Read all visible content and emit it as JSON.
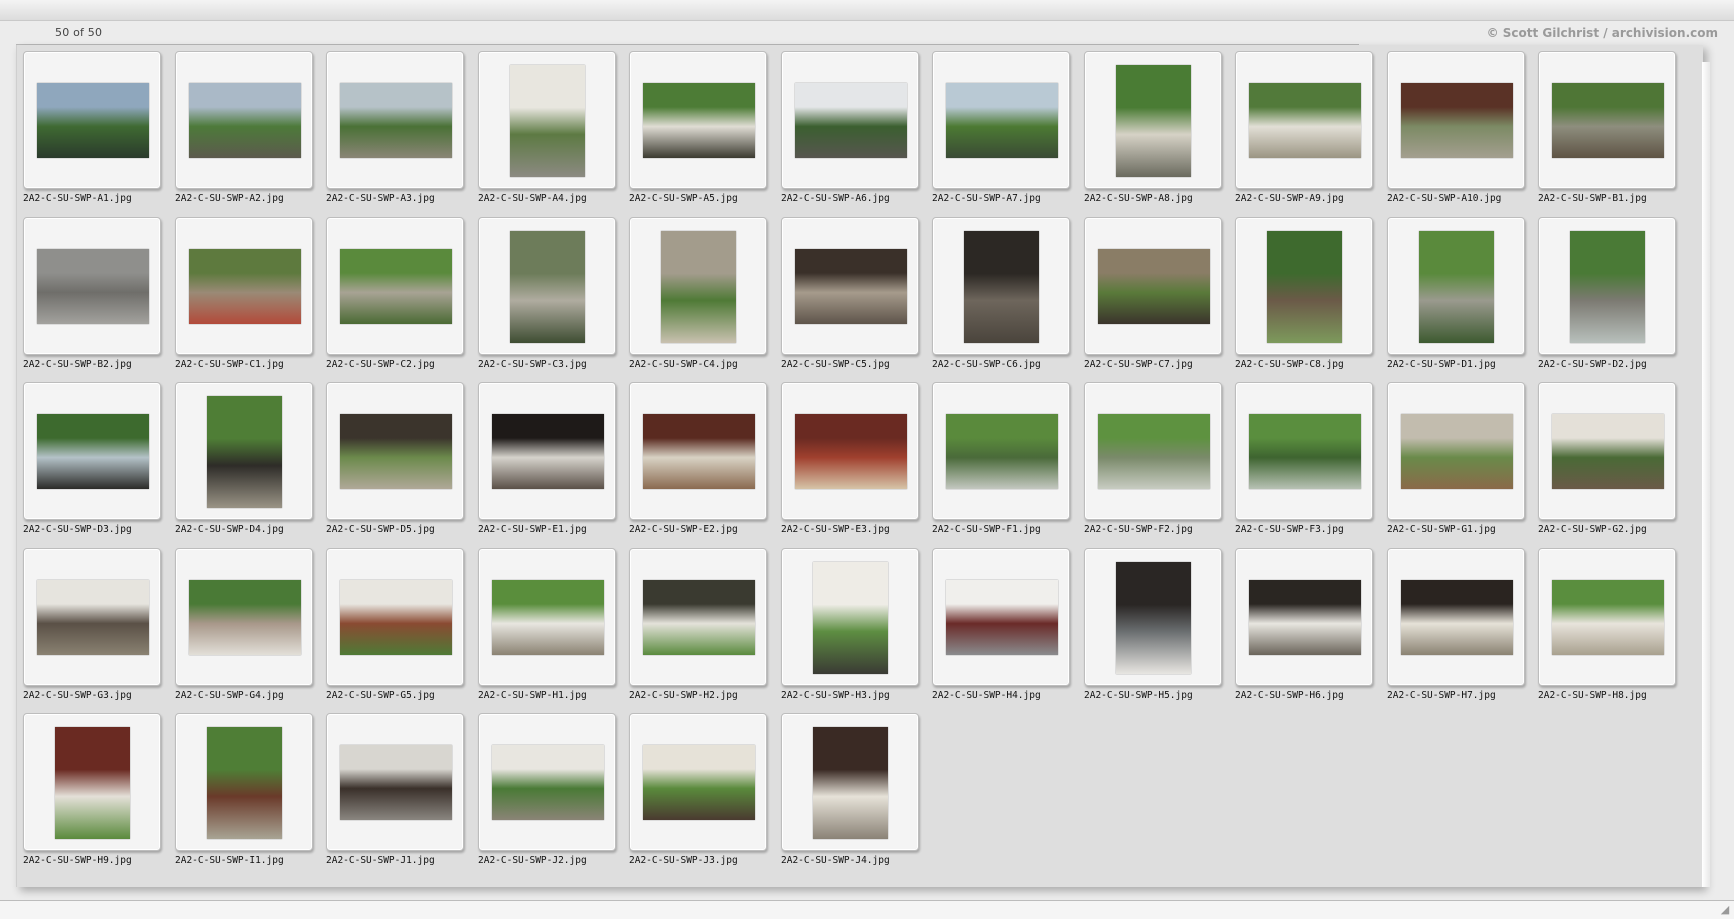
{
  "header": {
    "counter": "50 of 50",
    "copyright": "© Scott Gilchrist / archivision.com"
  },
  "gallery": {
    "items": [
      {
        "filename": "2A2-C-SU-SWP-A1.jpg",
        "orientation": "landscape",
        "palette": [
          "#8fa7bd",
          "#3f6a32",
          "#2a3a2c"
        ]
      },
      {
        "filename": "2A2-C-SU-SWP-A2.jpg",
        "orientation": "landscape",
        "palette": [
          "#aab9c7",
          "#4d7a3a",
          "#5c5a4d"
        ]
      },
      {
        "filename": "2A2-C-SU-SWP-A3.jpg",
        "orientation": "landscape",
        "palette": [
          "#b6c2c8",
          "#4a7136",
          "#8a8576"
        ]
      },
      {
        "filename": "2A2-C-SU-SWP-A4.jpg",
        "orientation": "portrait",
        "palette": [
          "#e8e6df",
          "#5d7a43",
          "#8c8a82"
        ]
      },
      {
        "filename": "2A2-C-SU-SWP-A5.jpg",
        "orientation": "landscape",
        "palette": [
          "#4d7c36",
          "#e0ddd4",
          "#3b3a30"
        ]
      },
      {
        "filename": "2A2-C-SU-SWP-A6.jpg",
        "orientation": "landscape",
        "palette": [
          "#e4e6e8",
          "#3b5f30",
          "#57564f"
        ]
      },
      {
        "filename": "2A2-C-SU-SWP-A7.jpg",
        "orientation": "landscape",
        "palette": [
          "#b9c9d4",
          "#4c7a33",
          "#3a4a35"
        ]
      },
      {
        "filename": "2A2-C-SU-SWP-A8.jpg",
        "orientation": "portrait",
        "palette": [
          "#4a7c34",
          "#d6d2c6",
          "#6a6a5e"
        ]
      },
      {
        "filename": "2A2-C-SU-SWP-A9.jpg",
        "orientation": "landscape",
        "palette": [
          "#527a3a",
          "#e2dfd6",
          "#9b9583"
        ]
      },
      {
        "filename": "2A2-C-SU-SWP-A10.jpg",
        "orientation": "landscape",
        "palette": [
          "#5a3226",
          "#7c8a64",
          "#a49f90"
        ]
      },
      {
        "filename": "2A2-C-SU-SWP-B1.jpg",
        "orientation": "landscape",
        "palette": [
          "#4f7636",
          "#8e8e7e",
          "#5e5344"
        ]
      },
      {
        "filename": "2A2-C-SU-SWP-B2.jpg",
        "orientation": "landscape",
        "palette": [
          "#8f8f8c",
          "#6f6e6a",
          "#a3a29e"
        ]
      },
      {
        "filename": "2A2-C-SU-SWP-C1.jpg",
        "orientation": "landscape",
        "palette": [
          "#5e7a3e",
          "#9a8a76",
          "#b24a3a"
        ]
      },
      {
        "filename": "2A2-C-SU-SWP-C2.jpg",
        "orientation": "landscape",
        "palette": [
          "#5a8a3c",
          "#a8a394",
          "#4b6a34"
        ]
      },
      {
        "filename": "2A2-C-SU-SWP-C3.jpg",
        "orientation": "portrait",
        "palette": [
          "#6d7c5a",
          "#b0aca0",
          "#3e4d32"
        ]
      },
      {
        "filename": "2A2-C-SU-SWP-C4.jpg",
        "orientation": "portrait",
        "palette": [
          "#a39c8c",
          "#4f7a36",
          "#c9c1b0"
        ]
      },
      {
        "filename": "2A2-C-SU-SWP-C5.jpg",
        "orientation": "landscape",
        "palette": [
          "#3a3029",
          "#a69b8c",
          "#5e544a"
        ]
      },
      {
        "filename": "2A2-C-SU-SWP-C6.jpg",
        "orientation": "portrait",
        "palette": [
          "#2c2824",
          "#6e665c",
          "#4a443c"
        ]
      },
      {
        "filename": "2A2-C-SU-SWP-C7.jpg",
        "orientation": "landscape",
        "palette": [
          "#8a7d66",
          "#5a7a3a",
          "#3b342c"
        ]
      },
      {
        "filename": "2A2-C-SU-SWP-C8.jpg",
        "orientation": "portrait",
        "palette": [
          "#3e6a2e",
          "#6b5a48",
          "#7d9a5c"
        ]
      },
      {
        "filename": "2A2-C-SU-SWP-D1.jpg",
        "orientation": "portrait",
        "palette": [
          "#5a8a3c",
          "#9a9a8e",
          "#3d5a30"
        ]
      },
      {
        "filename": "2A2-C-SU-SWP-D2.jpg",
        "orientation": "portrait",
        "palette": [
          "#4a7a36",
          "#7c7a72",
          "#b8c0bc"
        ]
      },
      {
        "filename": "2A2-C-SU-SWP-D3.jpg",
        "orientation": "landscape",
        "palette": [
          "#3d6a2e",
          "#b4c2c8",
          "#2b2b28"
        ]
      },
      {
        "filename": "2A2-C-SU-SWP-D4.jpg",
        "orientation": "portrait",
        "palette": [
          "#4f7e36",
          "#2e2c28",
          "#9a9486"
        ]
      },
      {
        "filename": "2A2-C-SU-SWP-D5.jpg",
        "orientation": "landscape",
        "palette": [
          "#3b342c",
          "#6c8a4c",
          "#b0a898"
        ]
      },
      {
        "filename": "2A2-C-SU-SWP-E1.jpg",
        "orientation": "landscape",
        "palette": [
          "#1e1a18",
          "#d6d3cc",
          "#5a5048"
        ]
      },
      {
        "filename": "2A2-C-SU-SWP-E2.jpg",
        "orientation": "landscape",
        "palette": [
          "#5a2a20",
          "#d8d2c4",
          "#8a6a50"
        ]
      },
      {
        "filename": "2A2-C-SU-SWP-E3.jpg",
        "orientation": "landscape",
        "palette": [
          "#6a2a22",
          "#a0402e",
          "#d6c4a8"
        ]
      },
      {
        "filename": "2A2-C-SU-SWP-F1.jpg",
        "orientation": "landscape",
        "palette": [
          "#5a8a3c",
          "#4a6a3a",
          "#c4c8c0"
        ]
      },
      {
        "filename": "2A2-C-SU-SWP-F2.jpg",
        "orientation": "landscape",
        "palette": [
          "#5e9240",
          "#7a8a6a",
          "#c8ccc2"
        ]
      },
      {
        "filename": "2A2-C-SU-SWP-F3.jpg",
        "orientation": "landscape",
        "palette": [
          "#5a8e3e",
          "#3e6430",
          "#b8c2b4"
        ]
      },
      {
        "filename": "2A2-C-SU-SWP-G1.jpg",
        "orientation": "landscape",
        "palette": [
          "#c2bcae",
          "#6a8a4a",
          "#8a6a4a"
        ]
      },
      {
        "filename": "2A2-C-SU-SWP-G2.jpg",
        "orientation": "landscape",
        "palette": [
          "#e4e0d8",
          "#4a6a36",
          "#6a5a48"
        ]
      },
      {
        "filename": "2A2-C-SU-SWP-G3.jpg",
        "orientation": "landscape",
        "palette": [
          "#e6e4de",
          "#5a5046",
          "#8a8272"
        ]
      },
      {
        "filename": "2A2-C-SU-SWP-G4.jpg",
        "orientation": "landscape",
        "palette": [
          "#4a7a36",
          "#a8988a",
          "#e2dfd8"
        ]
      },
      {
        "filename": "2A2-C-SU-SWP-G5.jpg",
        "orientation": "landscape",
        "palette": [
          "#e8e6e0",
          "#8a4a32",
          "#4f7a36"
        ]
      },
      {
        "filename": "2A2-C-SU-SWP-H1.jpg",
        "orientation": "landscape",
        "palette": [
          "#5a8e3c",
          "#e8e6e0",
          "#8a8272"
        ]
      },
      {
        "filename": "2A2-C-SU-SWP-H2.jpg",
        "orientation": "landscape",
        "palette": [
          "#3a3a30",
          "#e4e2da",
          "#5a8a3e"
        ]
      },
      {
        "filename": "2A2-C-SU-SWP-H3.jpg",
        "orientation": "portrait",
        "palette": [
          "#eeece6",
          "#5e8e42",
          "#3a3a34"
        ]
      },
      {
        "filename": "2A2-C-SU-SWP-H4.jpg",
        "orientation": "landscape",
        "palette": [
          "#f0efec",
          "#6a2a28",
          "#8a8c8e"
        ]
      },
      {
        "filename": "2A2-C-SU-SWP-H5.jpg",
        "orientation": "portrait",
        "palette": [
          "#2a2624",
          "#6a6e70",
          "#e8e6e2"
        ]
      },
      {
        "filename": "2A2-C-SU-SWP-H6.jpg",
        "orientation": "landscape",
        "palette": [
          "#2a2622",
          "#e8e6e0",
          "#6a645a"
        ]
      },
      {
        "filename": "2A2-C-SU-SWP-H7.jpg",
        "orientation": "landscape",
        "palette": [
          "#2a2420",
          "#e6e2d8",
          "#8a8272"
        ]
      },
      {
        "filename": "2A2-C-SU-SWP-H8.jpg",
        "orientation": "landscape",
        "palette": [
          "#5a8e3e",
          "#e8e4dc",
          "#a8a08e"
        ]
      },
      {
        "filename": "2A2-C-SU-SWP-H9.jpg",
        "orientation": "portrait",
        "palette": [
          "#6a2a22",
          "#e4e0d8",
          "#5a8a3c"
        ]
      },
      {
        "filename": "2A2-C-SU-SWP-I1.jpg",
        "orientation": "portrait",
        "palette": [
          "#4f7e36",
          "#6a3a2a",
          "#a8a494"
        ]
      },
      {
        "filename": "2A2-C-SU-SWP-J1.jpg",
        "orientation": "landscape",
        "palette": [
          "#d8d6d0",
          "#3a302a",
          "#8a8680"
        ]
      },
      {
        "filename": "2A2-C-SU-SWP-J2.jpg",
        "orientation": "landscape",
        "palette": [
          "#e8e6e0",
          "#4a7a36",
          "#8a8476"
        ]
      },
      {
        "filename": "2A2-C-SU-SWP-J3.jpg",
        "orientation": "landscape",
        "palette": [
          "#e6e2d8",
          "#5a8a3c",
          "#4a3a30"
        ]
      },
      {
        "filename": "2A2-C-SU-SWP-J4.jpg",
        "orientation": "portrait",
        "palette": [
          "#3a2a24",
          "#e6e2d8",
          "#8a8276"
        ]
      }
    ]
  }
}
